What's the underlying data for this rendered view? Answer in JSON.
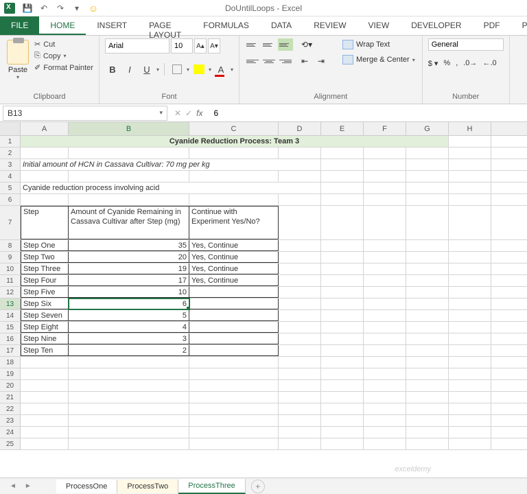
{
  "window": {
    "title": "DoUntilLoops - Excel"
  },
  "qat": {
    "undo": "↶",
    "redo": "↷",
    "smiley": "☺"
  },
  "ribbon_tabs": {
    "file": "FILE",
    "home": "HOME",
    "insert": "INSERT",
    "page_layout": "PAGE LAYOUT",
    "formulas": "FORMULAS",
    "data": "DATA",
    "review": "REVIEW",
    "view": "VIEW",
    "developer": "DEVELOPER",
    "pdf": "PDF",
    "power": "POWE"
  },
  "ribbon": {
    "clipboard": {
      "label": "Clipboard",
      "paste": "Paste",
      "cut": "Cut",
      "copy": "Copy",
      "format_painter": "Format Painter"
    },
    "font": {
      "label": "Font",
      "name": "Arial",
      "size": "10"
    },
    "alignment": {
      "label": "Alignment",
      "wrap": "Wrap Text",
      "merge": "Merge & Center"
    },
    "number": {
      "label": "Number",
      "format": "General"
    }
  },
  "formula_bar": {
    "cell_ref": "B13",
    "value": "6"
  },
  "columns": [
    "A",
    "B",
    "C",
    "D",
    "E",
    "F",
    "G",
    "H"
  ],
  "sheet": {
    "title": "Cyanide Reduction Process: Team 3",
    "r3": "Initial amount of HCN in Cassava Cultivar: 70 mg per kg",
    "r5": "Cyanide reduction process involving acid",
    "hdr": {
      "step": "Step",
      "amount": "Amount of Cyanide Remaining in Cassava Cultivar after Step (mg)",
      "cont": "Continue with Experiment Yes/No?"
    },
    "rows": [
      {
        "step": "Step One",
        "amt": "35",
        "cont": "Yes, Continue"
      },
      {
        "step": "Step Two",
        "amt": "20",
        "cont": "Yes, Continue"
      },
      {
        "step": "Step Three",
        "amt": "19",
        "cont": "Yes, Continue"
      },
      {
        "step": "Step Four",
        "amt": "17",
        "cont": "Yes, Continue"
      },
      {
        "step": "Step Five",
        "amt": "10",
        "cont": ""
      },
      {
        "step": "Step Six",
        "amt": "6",
        "cont": ""
      },
      {
        "step": "Step Seven",
        "amt": "5",
        "cont": ""
      },
      {
        "step": "Step Eight",
        "amt": "4",
        "cont": ""
      },
      {
        "step": "Step Nine",
        "amt": "3",
        "cont": ""
      },
      {
        "step": "Step Ten",
        "amt": "2",
        "cont": ""
      }
    ]
  },
  "sheet_tabs": {
    "one": "ProcessOne",
    "two": "ProcessTwo",
    "three": "ProcessThree"
  },
  "watermark": "exceldemy"
}
